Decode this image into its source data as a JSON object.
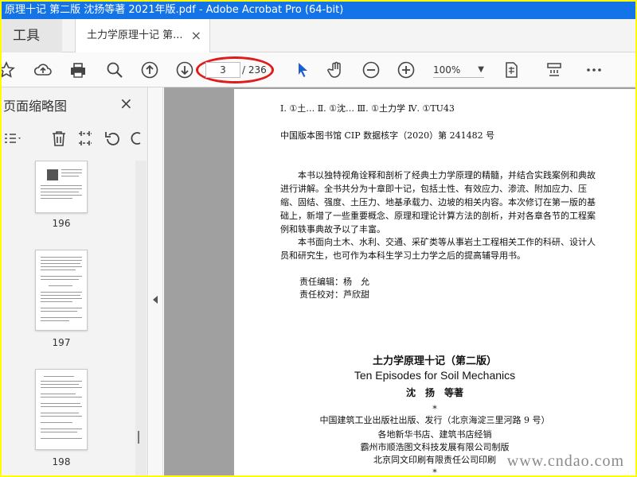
{
  "window": {
    "title": "原理十记 第二版 沈扬等著 2021年版.pdf - Adobe Acrobat Pro (64-bit)"
  },
  "tabs": {
    "tools_label": "工具",
    "document_label": "土力学原理十记 第...",
    "close_symbol": "×"
  },
  "toolbar": {
    "page_current": "3",
    "page_total": "/ 236",
    "zoom": "100%",
    "icons": [
      "star-icon",
      "cloud-upload-icon",
      "print-icon",
      "search-icon",
      "prev-page-icon",
      "next-page-icon",
      "select-cursor-icon",
      "hand-icon",
      "zoom-out-icon",
      "zoom-in-icon",
      "fit-page-icon",
      "scroll-mode-icon",
      "more-icon"
    ],
    "highlight_color": "#e01b1b"
  },
  "left_panel": {
    "title": "页面缩略图",
    "close_symbol": "×",
    "thumbnails": [
      {
        "label": "196"
      },
      {
        "label": "197"
      },
      {
        "label": "198"
      }
    ]
  },
  "document": {
    "catalog_line": "Ⅰ. ①土… Ⅱ. ①沈… Ⅲ. ①土力学 Ⅳ. ①TU43",
    "cip_line": "中国版本图书馆 CIP 数据核字（2020）第 241482 号",
    "summary_p1": "本书以独特视角诠释和剖析了经典土力学原理的精髓，并结合实践案例和典故进行讲解。全书共分为十章即十记，包括土性、有效应力、渗流、附加应力、压缩、固结、强度、土压力、地基承载力、边坡的相关内容。本次修订在第一版的基础上，新增了一些重要概念、原理和理论计算方法的剖析，并对各章各节的工程案例和轶事典故予以了丰富。",
    "summary_p2": "本书面向土木、水利、交通、采矿类等从事岩土工程相关工作的科研、设计人员和研究生，也可作为本科生学习土力学之后的提高辅导用书。",
    "editor_line": "责任编辑：杨　允",
    "proof_line": "责任校对：芦欣甜",
    "book_title_cn": "土力学原理十记（第二版）",
    "book_title_en": "Ten Episodes for Soil Mechanics",
    "authors": "沈　扬　等著",
    "star1": "*",
    "publisher": "中国建筑工业出版社出版、发行（北京海淀三里河路 9 号）",
    "distributor": "各地新华书店、建筑书店经销",
    "typesetter": "霸州市顺浩图文科技发展有限公司制版",
    "printer": "北京同文印刷有限责任公司印刷",
    "star2": "*"
  },
  "watermark": "www.cndao.com",
  "colors": {
    "titlebar": "#1473e6",
    "frame": "#ffff00",
    "doc_bg": "#a0a0a0"
  }
}
